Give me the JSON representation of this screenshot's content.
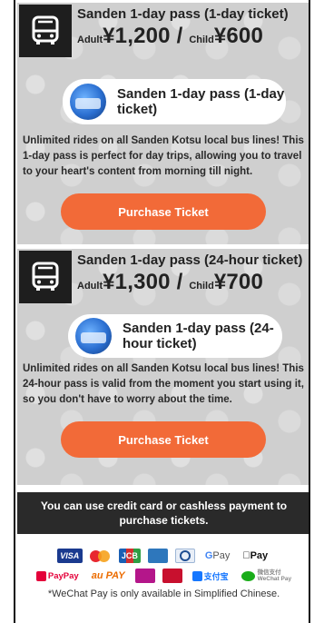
{
  "passes": [
    {
      "title": "Sanden 1-day pass (1-day ticket)",
      "adult_label": "Adult",
      "adult_price": "¥1,200",
      "separator": " / ",
      "child_label": "Child",
      "child_price": "¥600",
      "pill_line1": "Sanden 1-day pass (1-day",
      "pill_line2": "ticket)",
      "description": "Unlimited rides on all Sanden Kotsu local bus lines! This 1-day pass is perfect for day trips, allowing you to travel to your heart's content from morning till night.",
      "button_label": "Purchase Ticket"
    },
    {
      "title": "Sanden 1-day pass (24-hour ticket)",
      "adult_label": "Adult",
      "adult_price": "¥1,300",
      "separator": " / ",
      "child_label": "Child",
      "child_price": "¥700",
      "pill_line1": "Sanden 1-day pass (24-",
      "pill_line2": "hour ticket)",
      "description": "Unlimited rides on all Sanden Kotsu local bus lines! This 24-hour pass is valid from the moment you start using it, so you don't have to worry about the time.",
      "button_label": "Purchase Ticket"
    }
  ],
  "payment": {
    "notice_line1": "You can use credit card or cashless payment to",
    "notice_line2": "purchase tickets.",
    "row1": {
      "visa": "VISA",
      "jcb": "JCB",
      "amex": "AMEX",
      "gpay_g": "G",
      "gpay_text": " Pay",
      "apple_pay": " Pay"
    },
    "row2": {
      "paypay": "PayPay",
      "aupay": "au PAY",
      "aeon": "AEON Pay",
      "alipay": "支付宝",
      "wechat_cn": "微信支付",
      "wechat_en": "WeChat Pay"
    },
    "footnote": "*WeChat Pay is only available in Simplified Chinese."
  },
  "colors": {
    "card_bg": "#cfcfcf",
    "button": "#f26a38",
    "bus_box": "#1e1e1e",
    "notice_bg": "#2a2a2a"
  },
  "icons": {
    "pass_icon": "bus-icon",
    "pill_image": "bus-photo-icon"
  }
}
